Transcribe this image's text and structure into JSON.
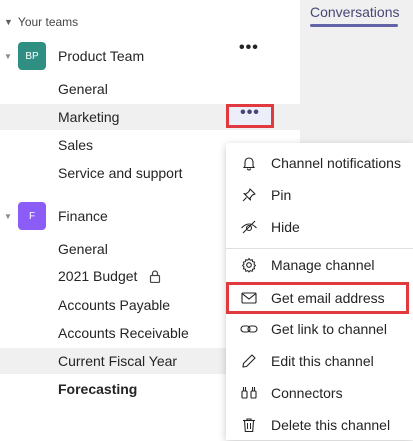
{
  "header": {
    "tab_conversations": "Conversations"
  },
  "sidebar": {
    "section_label": "Your teams",
    "teams": [
      {
        "name": "Product Team",
        "initials": "BP",
        "color": "#2f8f83",
        "channels": [
          {
            "label": "General"
          },
          {
            "label": "Marketing"
          },
          {
            "label": "Sales"
          },
          {
            "label": "Service and support"
          }
        ]
      },
      {
        "name": "Finance",
        "initials": "F",
        "color": "#8b5cf6",
        "channels": [
          {
            "label": "General"
          },
          {
            "label": "2021 Budget"
          },
          {
            "label": "Accounts Payable"
          },
          {
            "label": "Accounts Receivable"
          },
          {
            "label": "Current Fiscal Year"
          },
          {
            "label": "Forecasting"
          }
        ]
      }
    ]
  },
  "more_options_glyph": "•••",
  "team_more_glyph": "•••",
  "context_menu": {
    "items": [
      {
        "label": "Channel notifications",
        "icon": "bell-icon"
      },
      {
        "label": "Pin",
        "icon": "pin-icon"
      },
      {
        "label": "Hide",
        "icon": "hide-icon"
      },
      {
        "label": "Manage channel",
        "icon": "gear-icon"
      },
      {
        "label": "Get email address",
        "icon": "mail-icon"
      },
      {
        "label": "Get link to channel",
        "icon": "link-icon"
      },
      {
        "label": "Edit this channel",
        "icon": "pencil-icon"
      },
      {
        "label": "Connectors",
        "icon": "connectors-icon"
      },
      {
        "label": "Delete this channel",
        "icon": "trash-icon"
      }
    ]
  },
  "colors": {
    "accent": "#6264a7",
    "highlight_border": "#e0393e"
  }
}
